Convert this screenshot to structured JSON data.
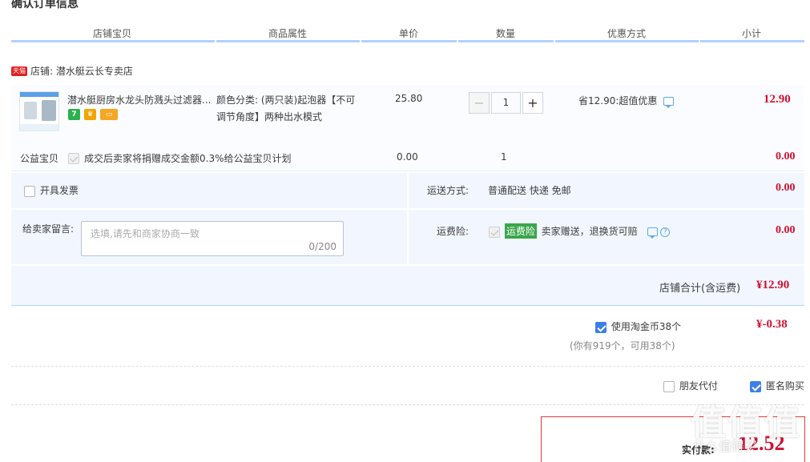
{
  "page": {
    "title": "确认订单信息"
  },
  "columns": [
    "店铺宝贝",
    "商品属性",
    "单价",
    "数量",
    "优惠方式",
    "小计"
  ],
  "shop": {
    "badge": "天猫",
    "label": "店铺: 潜水艇云长专卖店"
  },
  "item": {
    "name": "潜水艇厨房水龙头防溅头过滤器...",
    "attr_line1": "颜色分类: (两只装)起泡器【不可",
    "attr_line2": "调节角度】两种出水模式",
    "price": "25.80",
    "quantity": "1",
    "minus": "−",
    "plus": "+",
    "discount": "省12.90:超值优惠",
    "subtotal": "12.90",
    "service_icons": [
      {
        "glyph": "7",
        "color": "#2bb24c"
      },
      {
        "glyph": "♛",
        "color": "#f2a400"
      },
      {
        "glyph": "▭",
        "color": "#f5a623"
      }
    ]
  },
  "charity": {
    "label": "公益宝贝",
    "text": "成交后卖家将捐赠成交金额0.3%给公益宝贝计划",
    "price": "0.00",
    "quantity": "1",
    "subtotal": "0.00"
  },
  "invoice": {
    "label": "开具发票"
  },
  "shipping": {
    "label": "运送方式:",
    "value": "普通配送 快递 免邮",
    "amount": "0.00"
  },
  "memo": {
    "label": "给卖家留言:",
    "placeholder": "选填,请先和商家协商一致",
    "counter": "0/200"
  },
  "insurance": {
    "label": "运费险:",
    "tag": "运费险",
    "text": "卖家赠送，退换货可赔",
    "amount": "0.00"
  },
  "shop_total": {
    "label": "店铺合计(含运费)",
    "amount": "¥12.90"
  },
  "coins": {
    "label": "使用淘金币38个",
    "amount": "¥-0.38",
    "note": "(你有919个，可用38个)"
  },
  "options": {
    "friend_pay": "朋友代付",
    "anonymous": "匿名购买"
  },
  "payment": {
    "label": "实付款:",
    "amount": "12.52"
  },
  "watermark": {
    "main": "值值值",
    "sub": "什么值得买"
  }
}
